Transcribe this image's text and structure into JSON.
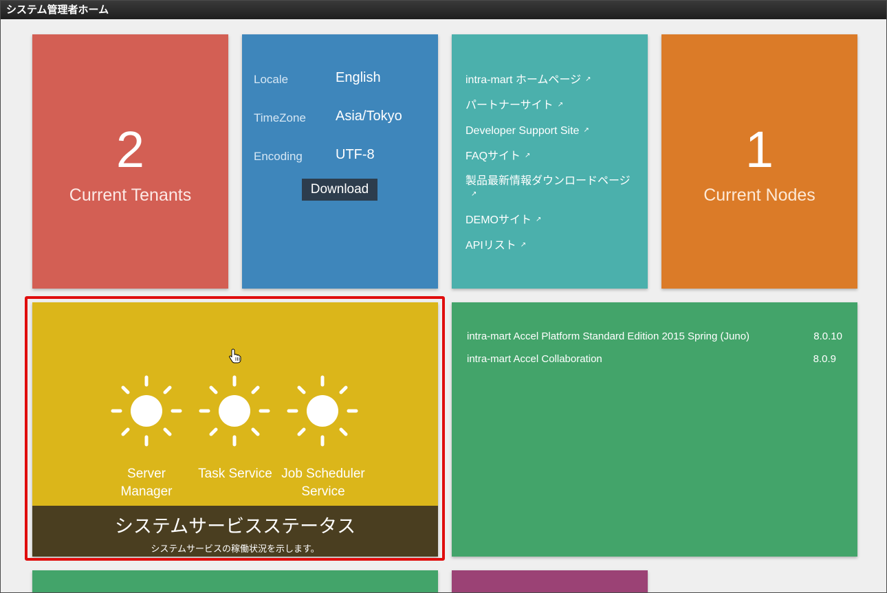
{
  "window": {
    "title": "システム管理者ホーム"
  },
  "tenants_tile": {
    "count": "2",
    "label": "Current Tenants",
    "color": "#d35f54"
  },
  "locale_tile": {
    "color": "#3e86bb",
    "rows": [
      {
        "key": "Locale",
        "value": "English"
      },
      {
        "key": "TimeZone",
        "value": "Asia/Tokyo"
      },
      {
        "key": "Encoding",
        "value": "UTF-8"
      }
    ],
    "download_label": "Download"
  },
  "links_tile": {
    "color": "#4bb0ac",
    "links": [
      {
        "label": "intra-mart ホームページ",
        "icon": "external-link-icon"
      },
      {
        "label": "パートナーサイト",
        "icon": "external-link-icon"
      },
      {
        "label": "Developer Support Site",
        "icon": "external-link-icon"
      },
      {
        "label": "FAQサイト",
        "icon": "external-link-icon"
      },
      {
        "label": "製品最新情報ダウンロードページ",
        "icon": "external-link-icon"
      },
      {
        "label": "DEMOサイト",
        "icon": "external-link-icon"
      },
      {
        "label": "APIリスト",
        "icon": "external-link-icon"
      }
    ]
  },
  "nodes_tile": {
    "count": "1",
    "label": "Current Nodes",
    "color": "#db7b28"
  },
  "service_status_tile": {
    "color": "#dbb61a",
    "services": [
      {
        "name": "Server Manager",
        "line1": "Server",
        "line2": "Manager",
        "status_icon": "sun-icon"
      },
      {
        "name": "Task Service",
        "line1": "Task Service",
        "line2": "",
        "status_icon": "sun-icon"
      },
      {
        "name": "Job Scheduler Service",
        "line1": "Job Scheduler",
        "line2": "Service",
        "status_icon": "sun-icon"
      }
    ],
    "title": "システムサービスステータス",
    "subtitle": "システムサービスの稼働状況を示します。"
  },
  "products_tile": {
    "color": "#43a46a",
    "products": [
      {
        "name": "intra-mart Accel Platform Standard Edition 2015 Spring (Juno)",
        "version": "8.0.10"
      },
      {
        "name": "intra-mart Accel Collaboration",
        "version": "8.0.9"
      }
    ]
  },
  "highlight_color": "#e00d0d"
}
